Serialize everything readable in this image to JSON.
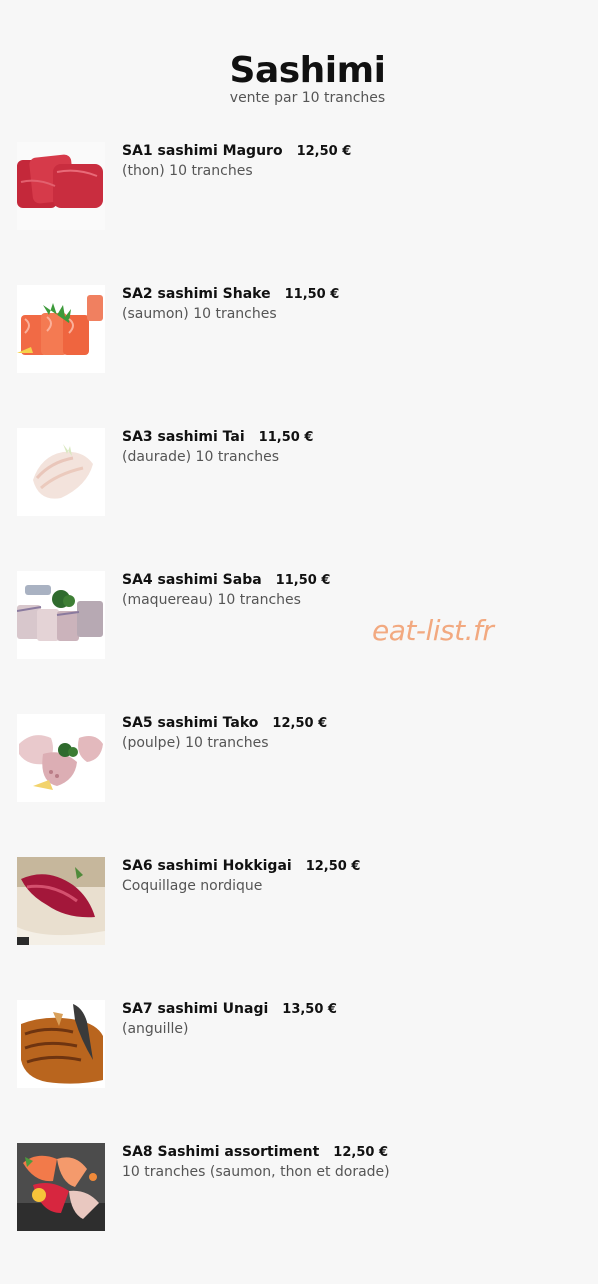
{
  "header": {
    "title": "Sashimi",
    "subtitle": "vente par 10 tranches"
  },
  "items": [
    {
      "code_name": "SA1 sashimi Maguro",
      "price": "12,50 €",
      "description": "(thon) 10 tranches",
      "image_icon": "tuna-sashimi-image"
    },
    {
      "code_name": "SA2 sashimi Shake",
      "price": "11,50 €",
      "description": "(saumon) 10 tranches",
      "image_icon": "salmon-sashimi-image"
    },
    {
      "code_name": "SA3 sashimi Tai",
      "price": "11,50 €",
      "description": "(daurade) 10 tranches",
      "image_icon": "sea-bream-sashimi-image"
    },
    {
      "code_name": "SA4 sashimi Saba",
      "price": "11,50 €",
      "description": "(maquereau) 10 tranches",
      "image_icon": "mackerel-sashimi-image"
    },
    {
      "code_name": "SA5 sashimi Tako",
      "price": "12,50 €",
      "description": "(poulpe) 10 tranches",
      "image_icon": "octopus-sashimi-image"
    },
    {
      "code_name": "SA6 sashimi Hokkigai",
      "price": "12,50 €",
      "description": "Coquillage nordique",
      "image_icon": "surf-clam-sashimi-image"
    },
    {
      "code_name": "SA7 sashimi Unagi",
      "price": "13,50 €",
      "description": "(anguille)",
      "image_icon": "eel-sashimi-image"
    },
    {
      "code_name": "SA8 Sashimi assortiment",
      "price": "12,50 €",
      "description": "10 tranches (saumon, thon et dorade)",
      "image_icon": "assorted-sashimi-image"
    }
  ],
  "watermark": "eat-list.fr",
  "colors": {
    "background": "#f7f7f7",
    "watermark": "#f2a980",
    "title": "#111111",
    "description": "#555555"
  }
}
